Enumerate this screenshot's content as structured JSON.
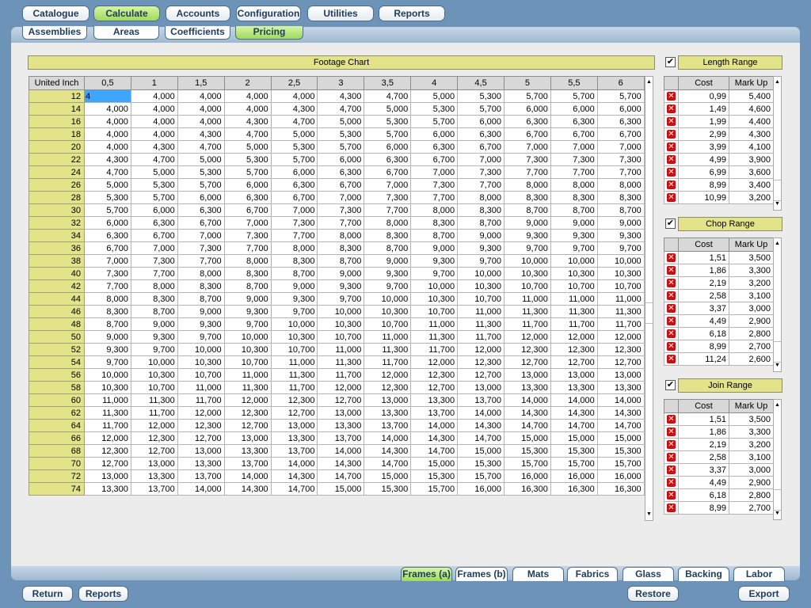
{
  "nav": {
    "top_tabs": [
      "Catalogue",
      "Calculate",
      "Accounts",
      "Configuration",
      "Utilities",
      "Reports"
    ],
    "active_top": "Calculate",
    "sub_tabs": [
      "Assemblies",
      "Areas",
      "Coefficients",
      "Pricing"
    ],
    "active_sub": "Pricing",
    "bottom_tabs": [
      "Frames (a)",
      "Frames (b)",
      "Mats",
      "Fabrics",
      "Glass",
      "Backing",
      "Labor"
    ],
    "active_bottom": "Frames (a)"
  },
  "footage_chart": {
    "title": "Footage Chart",
    "corner_label": "United Inch",
    "columns": [
      "0,5",
      "1",
      "1,5",
      "2",
      "2,5",
      "3",
      "3,5",
      "4",
      "4,5",
      "5",
      "5,5",
      "6"
    ],
    "editing_value": "4",
    "rows": [
      {
        "label": "12",
        "values": [
          "4",
          "4,000",
          "4,000",
          "4,000",
          "4,000",
          "4,300",
          "4,700",
          "5,000",
          "5,300",
          "5,700",
          "5,700",
          "5,700"
        ]
      },
      {
        "label": "14",
        "values": [
          "4,000",
          "4,000",
          "4,000",
          "4,000",
          "4,300",
          "4,700",
          "5,000",
          "5,300",
          "5,700",
          "6,000",
          "6,000",
          "6,000"
        ]
      },
      {
        "label": "16",
        "values": [
          "4,000",
          "4,000",
          "4,000",
          "4,300",
          "4,700",
          "5,000",
          "5,300",
          "5,700",
          "6,000",
          "6,300",
          "6,300",
          "6,300"
        ]
      },
      {
        "label": "18",
        "values": [
          "4,000",
          "4,000",
          "4,300",
          "4,700",
          "5,000",
          "5,300",
          "5,700",
          "6,000",
          "6,300",
          "6,700",
          "6,700",
          "6,700"
        ]
      },
      {
        "label": "20",
        "values": [
          "4,000",
          "4,300",
          "4,700",
          "5,000",
          "5,300",
          "5,700",
          "6,000",
          "6,300",
          "6,700",
          "7,000",
          "7,000",
          "7,000"
        ]
      },
      {
        "label": "22",
        "values": [
          "4,300",
          "4,700",
          "5,000",
          "5,300",
          "5,700",
          "6,000",
          "6,300",
          "6,700",
          "7,000",
          "7,300",
          "7,300",
          "7,300"
        ]
      },
      {
        "label": "24",
        "values": [
          "4,700",
          "5,000",
          "5,300",
          "5,700",
          "6,000",
          "6,300",
          "6,700",
          "7,000",
          "7,300",
          "7,700",
          "7,700",
          "7,700"
        ]
      },
      {
        "label": "26",
        "values": [
          "5,000",
          "5,300",
          "5,700",
          "6,000",
          "6,300",
          "6,700",
          "7,000",
          "7,300",
          "7,700",
          "8,000",
          "8,000",
          "8,000"
        ]
      },
      {
        "label": "28",
        "values": [
          "5,300",
          "5,700",
          "6,000",
          "6,300",
          "6,700",
          "7,000",
          "7,300",
          "7,700",
          "8,000",
          "8,300",
          "8,300",
          "8,300"
        ]
      },
      {
        "label": "30",
        "values": [
          "5,700",
          "6,000",
          "6,300",
          "6,700",
          "7,000",
          "7,300",
          "7,700",
          "8,000",
          "8,300",
          "8,700",
          "8,700",
          "8,700"
        ]
      },
      {
        "label": "32",
        "values": [
          "6,000",
          "6,300",
          "6,700",
          "7,000",
          "7,300",
          "7,700",
          "8,000",
          "8,300",
          "8,700",
          "9,000",
          "9,000",
          "9,000"
        ]
      },
      {
        "label": "34",
        "values": [
          "6,300",
          "6,700",
          "7,000",
          "7,300",
          "7,700",
          "8,000",
          "8,300",
          "8,700",
          "9,000",
          "9,300",
          "9,300",
          "9,300"
        ]
      },
      {
        "label": "36",
        "values": [
          "6,700",
          "7,000",
          "7,300",
          "7,700",
          "8,000",
          "8,300",
          "8,700",
          "9,000",
          "9,300",
          "9,700",
          "9,700",
          "9,700"
        ]
      },
      {
        "label": "38",
        "values": [
          "7,000",
          "7,300",
          "7,700",
          "8,000",
          "8,300",
          "8,700",
          "9,000",
          "9,300",
          "9,700",
          "10,000",
          "10,000",
          "10,000"
        ]
      },
      {
        "label": "40",
        "values": [
          "7,300",
          "7,700",
          "8,000",
          "8,300",
          "8,700",
          "9,000",
          "9,300",
          "9,700",
          "10,000",
          "10,300",
          "10,300",
          "10,300"
        ]
      },
      {
        "label": "42",
        "values": [
          "7,700",
          "8,000",
          "8,300",
          "8,700",
          "9,000",
          "9,300",
          "9,700",
          "10,000",
          "10,300",
          "10,700",
          "10,700",
          "10,700"
        ]
      },
      {
        "label": "44",
        "values": [
          "8,000",
          "8,300",
          "8,700",
          "9,000",
          "9,300",
          "9,700",
          "10,000",
          "10,300",
          "10,700",
          "11,000",
          "11,000",
          "11,000"
        ]
      },
      {
        "label": "46",
        "values": [
          "8,300",
          "8,700",
          "9,000",
          "9,300",
          "9,700",
          "10,000",
          "10,300",
          "10,700",
          "11,000",
          "11,300",
          "11,300",
          "11,300"
        ]
      },
      {
        "label": "48",
        "values": [
          "8,700",
          "9,000",
          "9,300",
          "9,700",
          "10,000",
          "10,300",
          "10,700",
          "11,000",
          "11,300",
          "11,700",
          "11,700",
          "11,700"
        ]
      },
      {
        "label": "50",
        "values": [
          "9,000",
          "9,300",
          "9,700",
          "10,000",
          "10,300",
          "10,700",
          "11,000",
          "11,300",
          "11,700",
          "12,000",
          "12,000",
          "12,000"
        ]
      },
      {
        "label": "52",
        "values": [
          "9,300",
          "9,700",
          "10,000",
          "10,300",
          "10,700",
          "11,000",
          "11,300",
          "11,700",
          "12,000",
          "12,300",
          "12,300",
          "12,300"
        ]
      },
      {
        "label": "54",
        "values": [
          "9,700",
          "10,000",
          "10,300",
          "10,700",
          "11,000",
          "11,300",
          "11,700",
          "12,000",
          "12,300",
          "12,700",
          "12,700",
          "12,700"
        ]
      },
      {
        "label": "56",
        "values": [
          "10,000",
          "10,300",
          "10,700",
          "11,000",
          "11,300",
          "11,700",
          "12,000",
          "12,300",
          "12,700",
          "13,000",
          "13,000",
          "13,000"
        ]
      },
      {
        "label": "58",
        "values": [
          "10,300",
          "10,700",
          "11,000",
          "11,300",
          "11,700",
          "12,000",
          "12,300",
          "12,700",
          "13,000",
          "13,300",
          "13,300",
          "13,300"
        ]
      },
      {
        "label": "60",
        "values": [
          "11,000",
          "11,300",
          "11,700",
          "12,000",
          "12,300",
          "12,700",
          "13,000",
          "13,300",
          "13,700",
          "14,000",
          "14,000",
          "14,000"
        ]
      },
      {
        "label": "62",
        "values": [
          "11,300",
          "11,700",
          "12,000",
          "12,300",
          "12,700",
          "13,000",
          "13,300",
          "13,700",
          "14,000",
          "14,300",
          "14,300",
          "14,300"
        ]
      },
      {
        "label": "64",
        "values": [
          "11,700",
          "12,000",
          "12,300",
          "12,700",
          "13,000",
          "13,300",
          "13,700",
          "14,000",
          "14,300",
          "14,700",
          "14,700",
          "14,700"
        ]
      },
      {
        "label": "66",
        "values": [
          "12,000",
          "12,300",
          "12,700",
          "13,000",
          "13,300",
          "13,700",
          "14,000",
          "14,300",
          "14,700",
          "15,000",
          "15,000",
          "15,000"
        ]
      },
      {
        "label": "68",
        "values": [
          "12,300",
          "12,700",
          "13,000",
          "13,300",
          "13,700",
          "14,000",
          "14,300",
          "14,700",
          "15,000",
          "15,300",
          "15,300",
          "15,300"
        ]
      },
      {
        "label": "70",
        "values": [
          "12,700",
          "13,000",
          "13,300",
          "13,700",
          "14,000",
          "14,300",
          "14,700",
          "15,000",
          "15,300",
          "15,700",
          "15,700",
          "15,700"
        ]
      },
      {
        "label": "72",
        "values": [
          "13,000",
          "13,300",
          "13,700",
          "14,000",
          "14,300",
          "14,700",
          "15,000",
          "15,300",
          "15,700",
          "16,000",
          "16,000",
          "16,000"
        ]
      },
      {
        "label": "74",
        "values": [
          "13,300",
          "13,700",
          "14,000",
          "14,300",
          "14,700",
          "15,000",
          "15,300",
          "15,700",
          "16,000",
          "16,300",
          "16,300",
          "16,300"
        ]
      }
    ]
  },
  "ranges": [
    {
      "title": "Length Range",
      "checked": true,
      "col_cost": "Cost",
      "col_markup": "Mark Up",
      "rows": [
        [
          "0,99",
          "5,400"
        ],
        [
          "1,49",
          "4,600"
        ],
        [
          "1,99",
          "4,400"
        ],
        [
          "2,99",
          "4,300"
        ],
        [
          "3,99",
          "4,100"
        ],
        [
          "4,99",
          "3,900"
        ],
        [
          "6,99",
          "3,600"
        ],
        [
          "8,99",
          "3,400"
        ],
        [
          "10,99",
          "3,200"
        ]
      ]
    },
    {
      "title": "Chop Range",
      "checked": true,
      "col_cost": "Cost",
      "col_markup": "Mark Up",
      "rows": [
        [
          "1,51",
          "3,500"
        ],
        [
          "1,86",
          "3,300"
        ],
        [
          "2,19",
          "3,200"
        ],
        [
          "2,58",
          "3,100"
        ],
        [
          "3,37",
          "3,000"
        ],
        [
          "4,49",
          "2,900"
        ],
        [
          "6,18",
          "2,800"
        ],
        [
          "8,99",
          "2,700"
        ],
        [
          "11,24",
          "2,600"
        ]
      ]
    },
    {
      "title": "Join Range",
      "checked": true,
      "col_cost": "Cost",
      "col_markup": "Mark Up",
      "rows": [
        [
          "1,51",
          "3,500"
        ],
        [
          "1,86",
          "3,300"
        ],
        [
          "2,19",
          "3,200"
        ],
        [
          "2,58",
          "3,100"
        ],
        [
          "3,37",
          "3,000"
        ],
        [
          "4,49",
          "2,900"
        ],
        [
          "6,18",
          "2,800"
        ],
        [
          "8,99",
          "2,700"
        ]
      ]
    }
  ],
  "footer": {
    "return_label": "Return",
    "reports_label": "Reports",
    "restore_label": "Restore",
    "export_label": "Export"
  },
  "icons": {
    "delete": "delete-x-icon",
    "checkbox": "check-icon",
    "scroll_up": "arrow-up-icon",
    "scroll_down": "arrow-down-icon"
  },
  "colors": {
    "background": "#6d93b8",
    "panel": "#ececec",
    "header_yellow": "#e3e38a",
    "active_tab_green": "#9fd95e",
    "selection_blue": "#3ea6ff",
    "delete_red": "#cc1010"
  }
}
